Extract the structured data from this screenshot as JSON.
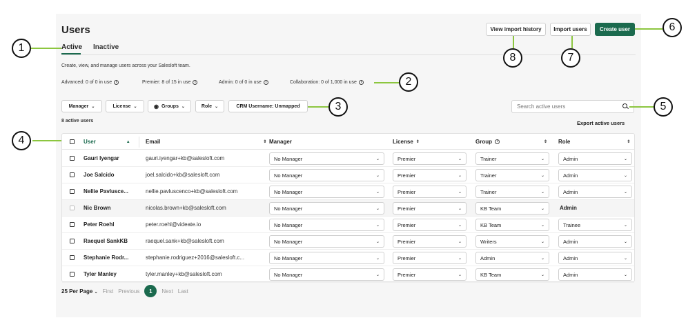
{
  "page": {
    "title": "Users",
    "tabs": [
      {
        "label": "Active",
        "active": true
      },
      {
        "label": "Inactive",
        "active": false
      }
    ],
    "description": "Create, view, and manage users across your Salesloft team.",
    "usage": [
      "Advanced: 0 of 0 in use",
      "Premier: 8 of 15 in use",
      "Admin: 0 of 0 in use",
      "Collaboration: 0 of 1,000 in use"
    ]
  },
  "header_buttons": {
    "view_import_history": "View import history",
    "import_users": "Import users",
    "create_user": "Create user"
  },
  "filters": {
    "manager": "Manager",
    "license": "License",
    "groups": "Groups",
    "role": "Role",
    "crm": "CRM Username: Unmapped"
  },
  "search": {
    "placeholder": "Search active users"
  },
  "toolbar": {
    "count": "8 active users",
    "export": "Export active users"
  },
  "table": {
    "columns": [
      "User",
      "Email",
      "Manager",
      "License",
      "Group",
      "Role"
    ],
    "rows": [
      {
        "user": "Gauri Iyengar",
        "email": "gauri.iyengar+kb@salesloft.com",
        "manager": "No Manager",
        "license": "Premier",
        "group": "Trainer",
        "role": "Admin",
        "role_editable": true
      },
      {
        "user": "Joe Salcido",
        "email": "joel.salcido+kb@salesloft.com",
        "manager": "No Manager",
        "license": "Premier",
        "group": "Trainer",
        "role": "Admin",
        "role_editable": true
      },
      {
        "user": "Nellie Pavlusce...",
        "email": "nellie.pavluscenco+kb@salesloft.com",
        "manager": "No Manager",
        "license": "Premier",
        "group": "Trainer",
        "role": "Admin",
        "role_editable": true
      },
      {
        "user": "Nic Brown",
        "email": "nicolas.brown+kb@salesloft.com",
        "manager": "No Manager",
        "license": "Premier",
        "group": "KB Team",
        "role": "Admin",
        "role_editable": false
      },
      {
        "user": "Peter Roehl",
        "email": "peter.roehl@videate.io",
        "manager": "No Manager",
        "license": "Premier",
        "group": "KB Team",
        "role": "Trainee",
        "role_editable": true
      },
      {
        "user": "Raequel SankKB",
        "email": "raequel.sank+kb@salesloft.com",
        "manager": "No Manager",
        "license": "Premier",
        "group": "Writers",
        "role": "Admin",
        "role_editable": true
      },
      {
        "user": "Stephanie Rodr...",
        "email": "stephanie.rodriguez+2016@salesloft.c...",
        "manager": "No Manager",
        "license": "Premier",
        "group": "Admin",
        "role": "Admin",
        "role_editable": true
      },
      {
        "user": "Tyler Manley",
        "email": "tyler.manley+kb@salesloft.com",
        "manager": "No Manager",
        "license": "Premier",
        "group": "KB Team",
        "role": "Admin",
        "role_editable": true
      }
    ]
  },
  "pagination": {
    "per_page": "25 Per Page",
    "first": "First",
    "previous": "Previous",
    "current": "1",
    "next": "Next",
    "last": "Last"
  },
  "callouts": [
    "1",
    "2",
    "3",
    "4",
    "5",
    "6",
    "7",
    "8"
  ],
  "colors": {
    "accent": "#1b6a4e",
    "callout_line": "#8cc63f"
  }
}
